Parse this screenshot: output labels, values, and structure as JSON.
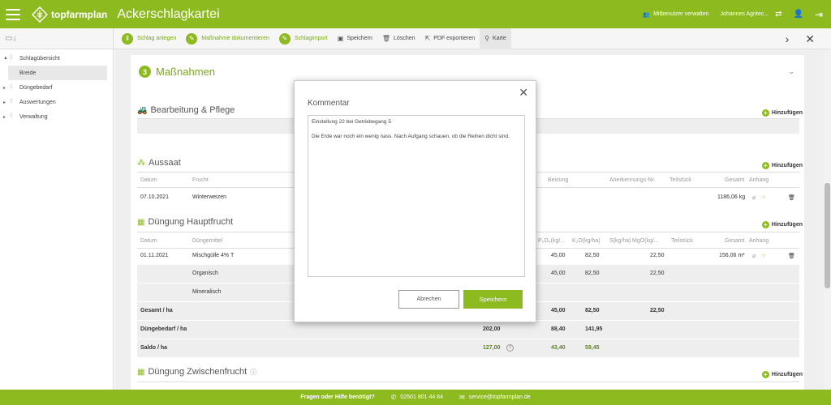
{
  "app": {
    "brand": "topfarmplan",
    "title": "Ackerschlagkartei"
  },
  "topbar": {
    "co_users": "Mitbenutzer verwalten",
    "user": "Johannes Agritec..."
  },
  "toolbar": {
    "items": [
      {
        "label": "Schlag anlegen"
      },
      {
        "label": "Maßnahme dokumentieren"
      },
      {
        "label": "Schlagimport"
      },
      {
        "label": "Speichern"
      },
      {
        "label": "Löschen"
      },
      {
        "label": "PDF exportieren"
      },
      {
        "label": "Karte"
      }
    ]
  },
  "sidebar": {
    "items": [
      {
        "label": "Schlagübersicht"
      },
      {
        "label": "Breide"
      },
      {
        "label": "Düngebedarf"
      },
      {
        "label": "Auswertungen"
      },
      {
        "label": "Verwaltung"
      }
    ]
  },
  "section": {
    "number": "3",
    "title": "Maßnahmen"
  },
  "add_label": "Hinzufügen",
  "bearbeitung": {
    "title": "Bearbeitung & Pflege"
  },
  "aussaat": {
    "title": "Aussaat",
    "headers": [
      "Datum",
      "Frucht",
      "Beizung",
      "Anerkennungs-Nr.",
      "Teilstück",
      "Gesamt",
      "Anhang"
    ],
    "row": {
      "datum": "07.10.2021",
      "frucht": "Winterweizen",
      "gesamt": "1186,06 kg"
    }
  },
  "duengung": {
    "title": "Düngung Hauptfrucht",
    "headers": [
      "Datum",
      "Düngemittel",
      "P₂O₅(kg/...",
      "K₂O(kg/ha)",
      "S(kg/ha)",
      "MgO(kg/...",
      "Teilstück",
      "Gesamt",
      "Anhang"
    ],
    "row": {
      "datum": "01.11.2021",
      "mittel": "Mischgülle 4% T",
      "p": "45,00",
      "k": "82,50",
      "mg": "22,50",
      "gesamt": "156,06 m³"
    },
    "organisch": {
      "label": "Organisch",
      "p": "45,00",
      "k": "82,50",
      "mg": "22,50"
    },
    "mineralisch": {
      "label": "Mineralisch"
    },
    "gesamt": {
      "label": "Gesamt / ha",
      "p": "45,00",
      "k": "82,50",
      "mg": "22,50"
    },
    "bedarf": {
      "label": "Düngebedarf / ha",
      "n": "202,00",
      "p": "88,40",
      "k": "141,95"
    },
    "saldo": {
      "label": "Saldo / ha",
      "n": "127,00",
      "p": "43,40",
      "k": "59,45"
    }
  },
  "zwischenfrucht": {
    "title": "Düngung Zwischenfrucht"
  },
  "modal": {
    "title": "Kommentar",
    "text": "Einstellung 22 bei Getriebegang 5\n\nDie Erde war noch ein wenig nass. Nach Aufgang schauen, ob die Reihen dicht sind.",
    "cancel": "Abrechen",
    "save": "Speichern"
  },
  "footer": {
    "help": "Fragen oder Hilfe benötigt?",
    "phone": "02501 801 44 84",
    "email": "service@topfarmplan.de"
  }
}
